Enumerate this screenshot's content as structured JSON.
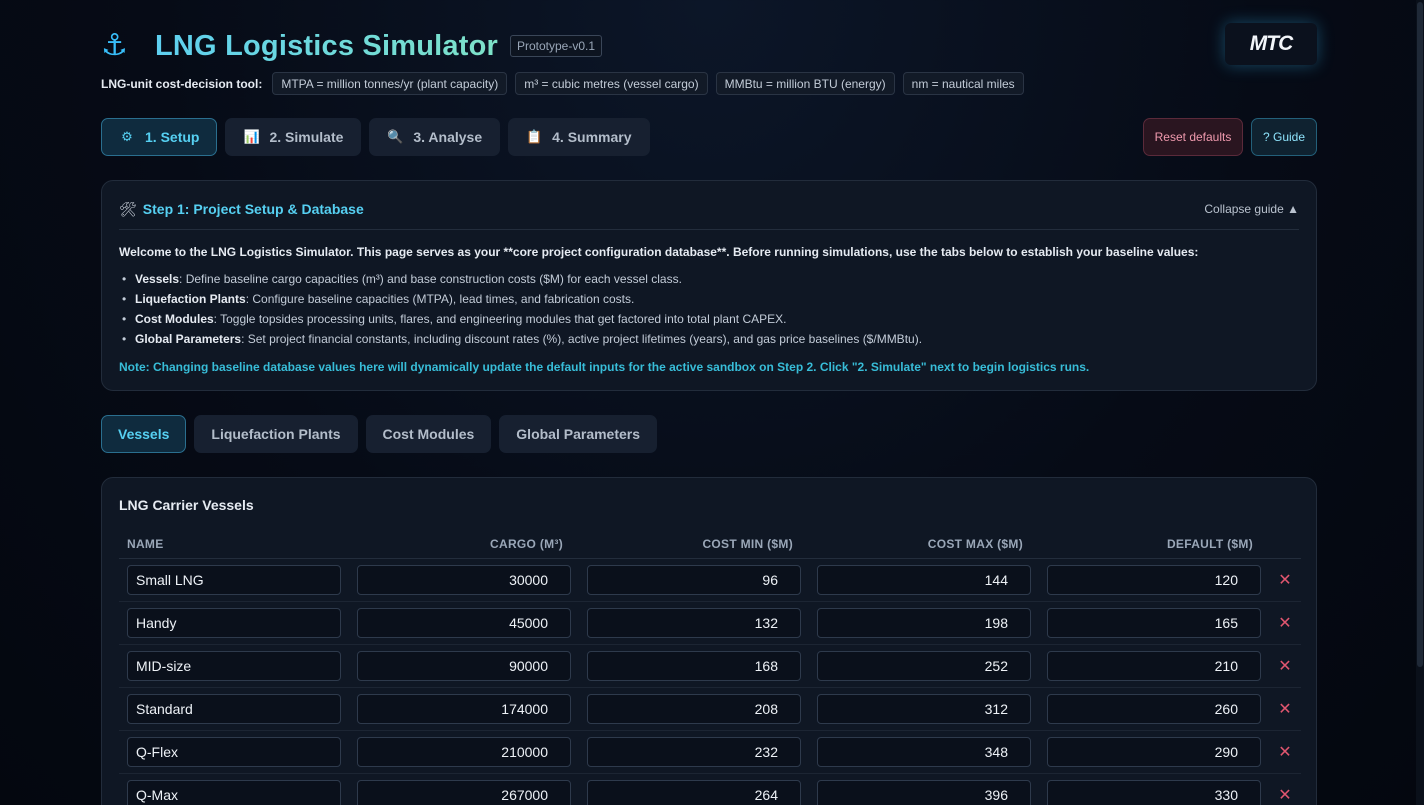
{
  "header": {
    "title": "LNG Logistics Simulator",
    "badge": "Prototype-v0.1",
    "logo_text": "MTC",
    "anchor_icon": "⚓"
  },
  "units": {
    "label": "LNG-unit cost-decision tool:",
    "chips": [
      "MTPA = million tonnes/yr (plant capacity)",
      "m³ = cubic metres (vessel cargo)",
      "MMBtu = million BTU (energy)",
      "nm = nautical miles"
    ]
  },
  "main_tabs": [
    {
      "label": "1. Setup",
      "icon": "gear-icon",
      "glyph": "⚙",
      "active": true
    },
    {
      "label": "2. Simulate",
      "icon": "bar-chart-icon",
      "glyph": "📊",
      "active": false
    },
    {
      "label": "3. Analyse",
      "icon": "magnifier-icon",
      "glyph": "🔍",
      "active": false
    },
    {
      "label": "4. Summary",
      "icon": "clipboard-icon",
      "glyph": "📋",
      "active": false
    }
  ],
  "actions": {
    "reset": "Reset defaults",
    "guide": "? Guide"
  },
  "guide": {
    "title": "Step 1: Project Setup & Database",
    "collapse": "Collapse guide ▲",
    "intro": "Welcome to the LNG Logistics Simulator. This page serves as your **core project configuration database**. Before running simulations, use the tabs below to establish your baseline values:",
    "items": [
      {
        "term": "Vessels",
        "text": ": Define baseline cargo capacities (m³) and base construction costs ($M) for each vessel class."
      },
      {
        "term": "Liquefaction Plants",
        "text": ": Configure baseline capacities (MTPA), lead times, and fabrication costs."
      },
      {
        "term": "Cost Modules",
        "text": ": Toggle topsides processing units, flares, and engineering modules that get factored into total plant CAPEX."
      },
      {
        "term": "Global Parameters",
        "text": ": Set project financial constants, including discount rates (%), active project lifetimes (years), and gas price baselines ($/MMBtu)."
      }
    ],
    "note": "Note: Changing baseline database values here will dynamically update the default inputs for the active sandbox on Step 2. Click \"2. Simulate\" next to begin logistics runs."
  },
  "sub_tabs": [
    {
      "label": "Vessels",
      "active": true
    },
    {
      "label": "Liquefaction Plants",
      "active": false
    },
    {
      "label": "Cost Modules",
      "active": false
    },
    {
      "label": "Global Parameters",
      "active": false
    }
  ],
  "vessels": {
    "title": "LNG Carrier Vessels",
    "columns": [
      "Name",
      "Cargo (m³)",
      "Cost Min ($M)",
      "Cost Max ($M)",
      "Default ($M)"
    ],
    "rows": [
      {
        "name": "Small LNG",
        "cargo": "30000",
        "min": "96",
        "max": "144",
        "default": "120"
      },
      {
        "name": "Handy",
        "cargo": "45000",
        "min": "132",
        "max": "198",
        "default": "165"
      },
      {
        "name": "MID-size",
        "cargo": "90000",
        "min": "168",
        "max": "252",
        "default": "210"
      },
      {
        "name": "Standard",
        "cargo": "174000",
        "min": "208",
        "max": "312",
        "default": "260"
      },
      {
        "name": "Q-Flex",
        "cargo": "210000",
        "min": "232",
        "max": "348",
        "default": "290"
      },
      {
        "name": "Q-Max",
        "cargo": "267000",
        "min": "264",
        "max": "396",
        "default": "330"
      }
    ],
    "delete_glyph": "✕"
  },
  "colors": {
    "accent": "#56d0f2",
    "danger": "#e0566f",
    "background": "#060b16"
  }
}
